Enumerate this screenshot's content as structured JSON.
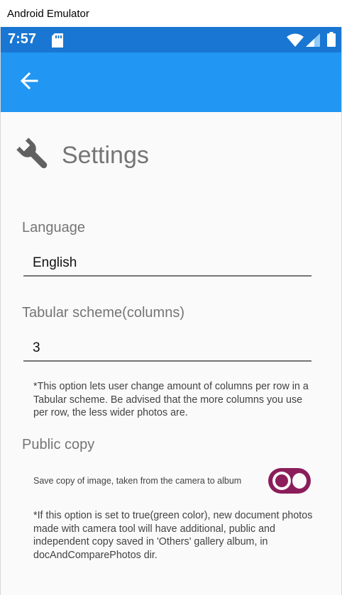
{
  "window": {
    "title": "Android Emulator"
  },
  "status_bar": {
    "time": "7:57",
    "icons": [
      "sd-card-icon",
      "wifi-icon",
      "signal-icon",
      "battery-icon"
    ]
  },
  "app_bar": {
    "back_icon": "arrow-back-icon"
  },
  "page": {
    "title": "Settings",
    "icon": "wrench-icon"
  },
  "language": {
    "label": "Language",
    "value": "English"
  },
  "tabular": {
    "label": "Tabular scheme(columns)",
    "value": "3",
    "note": "*This option lets user change amount of columns per row in a Tabular scheme. Be advised that the more columns you use per row, the less wider photos are."
  },
  "public_copy": {
    "label": "Public copy",
    "toggle_label": "Save copy of image, taken from the camera to album",
    "toggle_state": "off",
    "note": "*If this option is set to true(green color), new document photos made with camera tool will have additional, public and independent copy saved in 'Others' gallery album, in docAndComparePhotos dir."
  },
  "colors": {
    "status_bar": "#1976d2",
    "app_bar": "#2196f3",
    "switch": "#8b1d5a",
    "label_gray": "#757575"
  }
}
